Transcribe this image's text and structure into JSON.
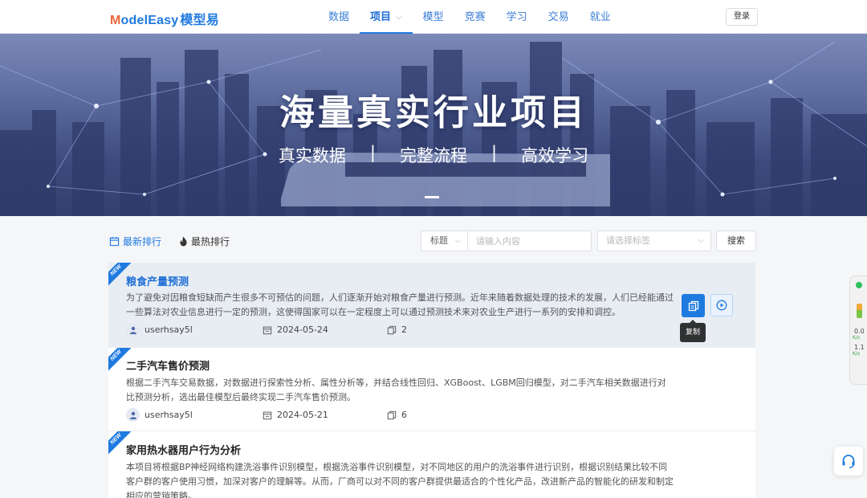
{
  "header": {
    "logo_en": "odelEasy",
    "logo_m": "M",
    "logo_cn": "模型易",
    "nav": [
      {
        "label": "数据"
      },
      {
        "label": "项目",
        "active": true
      },
      {
        "label": "模型"
      },
      {
        "label": "竞赛"
      },
      {
        "label": "学习"
      },
      {
        "label": "交易"
      },
      {
        "label": "就业"
      }
    ],
    "login_label": "登录"
  },
  "banner": {
    "title": "海量真实行业项目",
    "subtitle": [
      "真实数据",
      "完整流程",
      "高效学习"
    ],
    "separator": "|"
  },
  "toolbar": {
    "tab_new": "最新排行",
    "tab_hot": "最热排行",
    "type_select": "标题",
    "search_placeholder": "请输入内容",
    "tag_placeholder": "请选择标签",
    "search_button": "搜索"
  },
  "projects": [
    {
      "badge": "NEW",
      "title": "粮食产量预测",
      "desc": "为了避免对因粮食短缺而产生很多不可预估的问题，人们逐渐开始对粮食产量进行预测。近年来随着数据处理的技术的发展，人们已经能通过一些算法对农业信息进行一定的预测，这使得国家可以在一定程度上可以通过预测技术来对农业生产进行一系列的安排和调控。",
      "user": "userhsay5l",
      "date": "2024-05-24",
      "count": "2"
    },
    {
      "badge": "NEW",
      "title": "二手汽车售价预测",
      "desc": "根据二手汽车交易数据，对数据进行探索性分析、属性分析等，并结合线性回归、XGBoost、LGBM回归模型，对二手汽车相关数据进行对比预测分析，选出最佳模型后最终实现二手汽车售价预测。",
      "user": "userhsay5l",
      "date": "2024-05-21",
      "count": "6"
    },
    {
      "badge": "NEW",
      "title": "家用热水器用户行为分析",
      "desc": "本项目将根据BP神经网络构建洗浴事件识别模型，根据洗浴事件识别模型，对不同地区的用户的洗浴事件进行识别，根据识别结果比较不同客户群的客户使用习惯，加深对客户的理解等。从而，厂商可以对不同的客户群提供最适合的个性化产品，改进新产品的智能化的研发和制定相应的营销策略。"
    }
  ],
  "tooltip": "复制",
  "speed_widget": {
    "up": "0.0",
    "up_unit": "K/s",
    "down": "1.1",
    "down_unit": "K/s"
  }
}
